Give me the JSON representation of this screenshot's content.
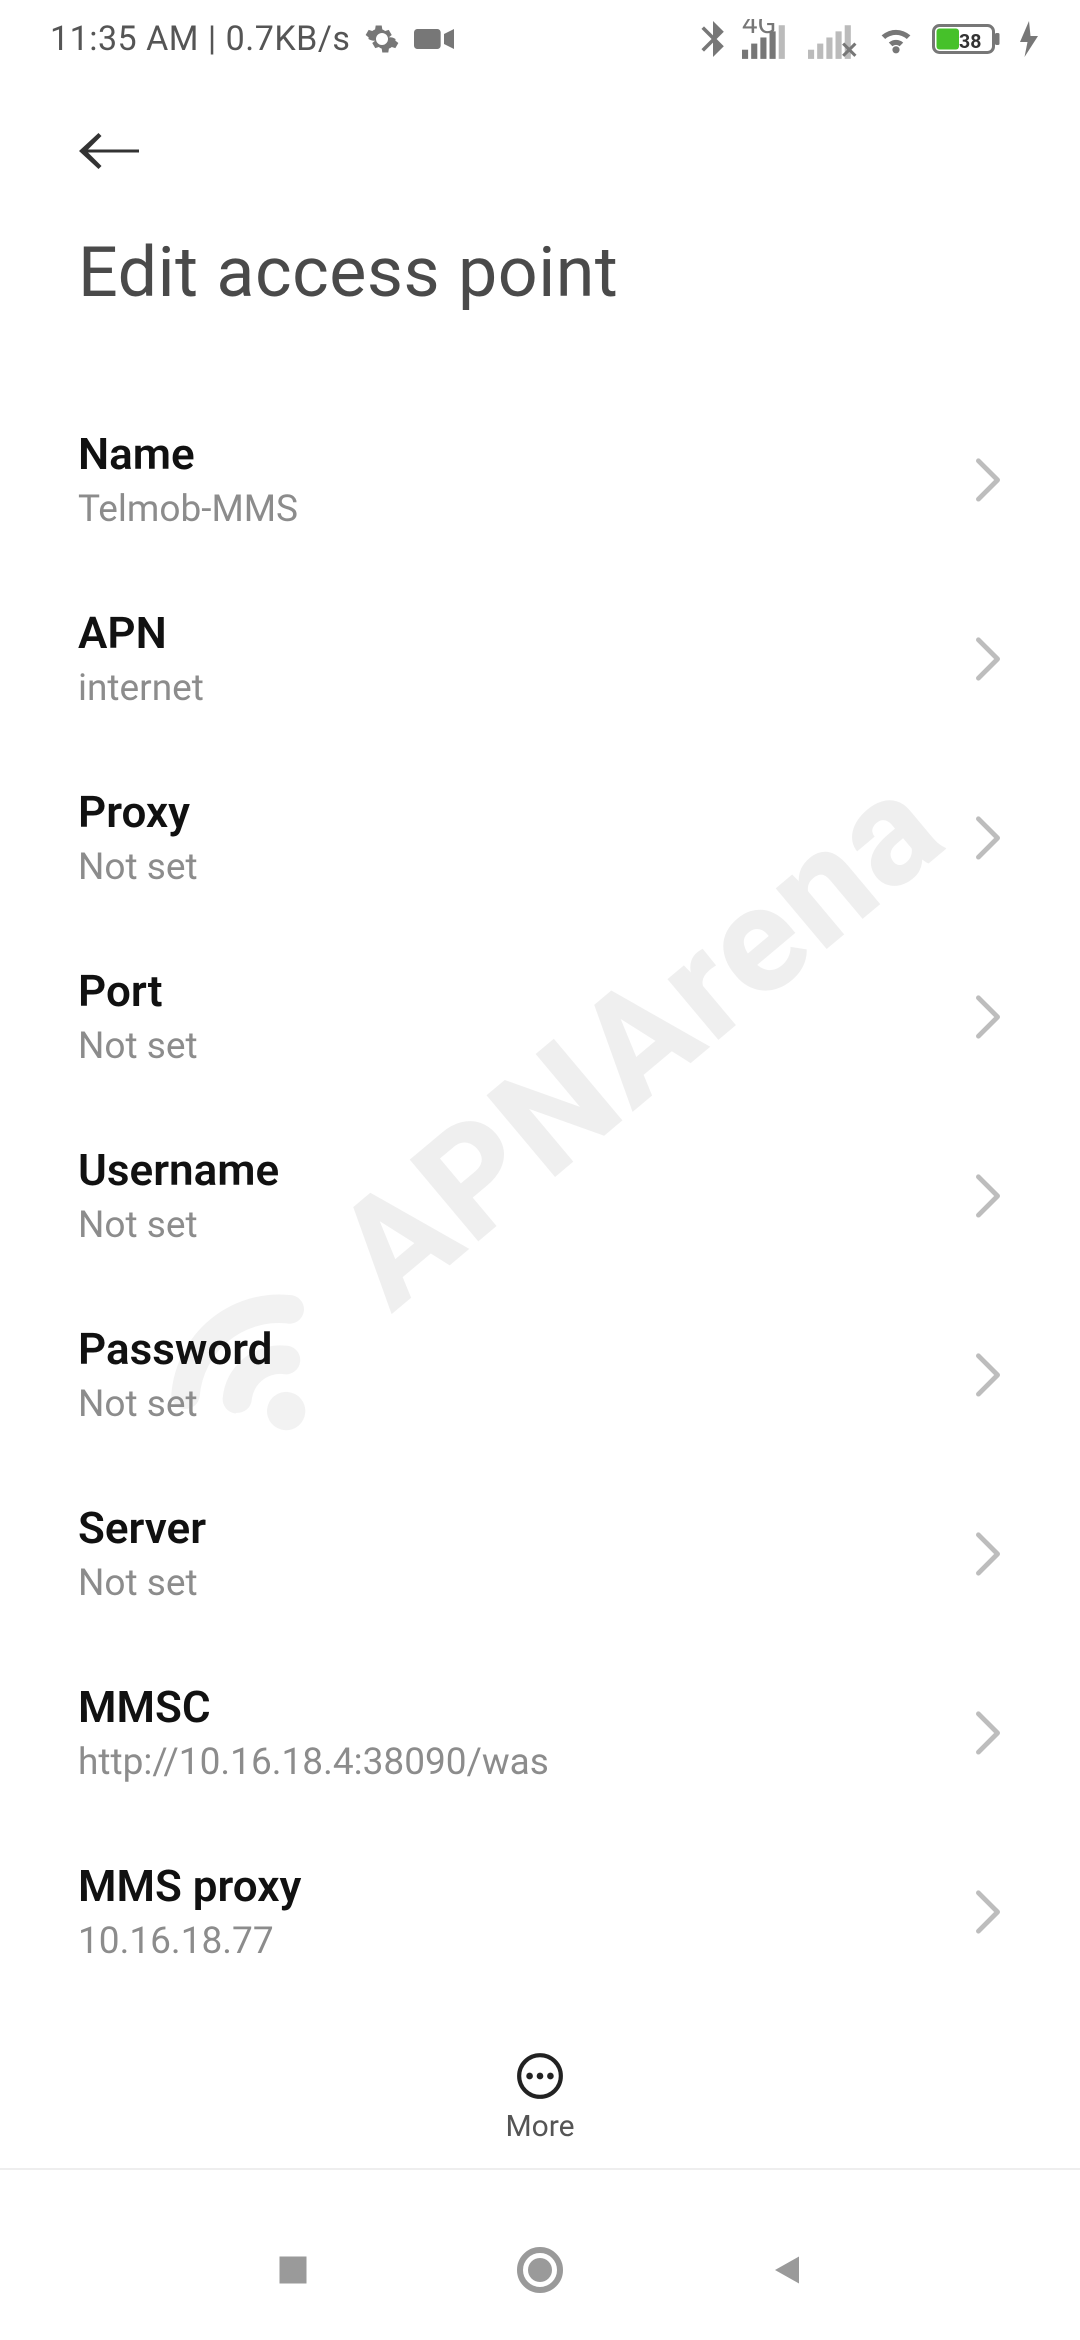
{
  "status": {
    "time": "11:35 AM",
    "net_speed": "0.7KB/s",
    "signal_label": "4G",
    "battery_pct": "38"
  },
  "header": {
    "title": "Edit access point"
  },
  "items": [
    {
      "key": "name",
      "title": "Name",
      "value": "Telmob-MMS"
    },
    {
      "key": "apn",
      "title": "APN",
      "value": "internet"
    },
    {
      "key": "proxy",
      "title": "Proxy",
      "value": "Not set"
    },
    {
      "key": "port",
      "title": "Port",
      "value": "Not set"
    },
    {
      "key": "username",
      "title": "Username",
      "value": "Not set"
    },
    {
      "key": "password",
      "title": "Password",
      "value": "Not set"
    },
    {
      "key": "server",
      "title": "Server",
      "value": "Not set"
    },
    {
      "key": "mmsc",
      "title": "MMSC",
      "value": "http://10.16.18.4:38090/was"
    },
    {
      "key": "mmsproxy",
      "title": "MMS proxy",
      "value": "10.16.18.77"
    }
  ],
  "more_label": "More",
  "watermark_text": "APNArena"
}
